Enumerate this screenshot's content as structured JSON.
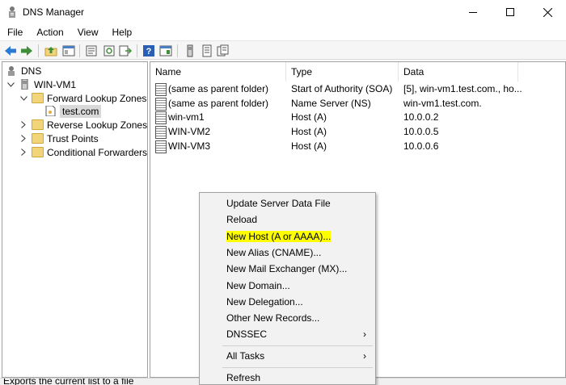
{
  "window": {
    "title": "DNS Manager"
  },
  "menubar": [
    "File",
    "Action",
    "View",
    "Help"
  ],
  "tree": {
    "root": "DNS",
    "server": "WIN-VM1",
    "forward": "Forward Lookup Zones",
    "zone": "test.com",
    "reverse": "Reverse Lookup Zones",
    "trust": "Trust Points",
    "conditional": "Conditional Forwarders"
  },
  "table": {
    "headers": [
      "Name",
      "Type",
      "Data"
    ],
    "rows": [
      {
        "name": "(same as parent folder)",
        "type": "Start of Authority (SOA)",
        "data": "[5], win-vm1.test.com., ho..."
      },
      {
        "name": "(same as parent folder)",
        "type": "Name Server (NS)",
        "data": "win-vm1.test.com."
      },
      {
        "name": "win-vm1",
        "type": "Host (A)",
        "data": "10.0.0.2"
      },
      {
        "name": "WIN-VM2",
        "type": "Host (A)",
        "data": "10.0.0.5"
      },
      {
        "name": "WIN-VM3",
        "type": "Host (A)",
        "data": "10.0.0.6"
      }
    ]
  },
  "context_menu": {
    "items": [
      "Update Server Data File",
      "Reload",
      "New Host (A or AAAA)...",
      "New Alias (CNAME)...",
      "New Mail Exchanger (MX)...",
      "New Domain...",
      "New Delegation...",
      "Other New Records...",
      "DNSSEC",
      "All Tasks",
      "Refresh"
    ],
    "highlighted": "New Host (A or AAAA)..."
  },
  "status": {
    "text": "Exports the current list to a file"
  },
  "colors": {
    "highlight": "#ffff00",
    "folder": "#f2d57a",
    "selection": "#d9d9d9"
  }
}
